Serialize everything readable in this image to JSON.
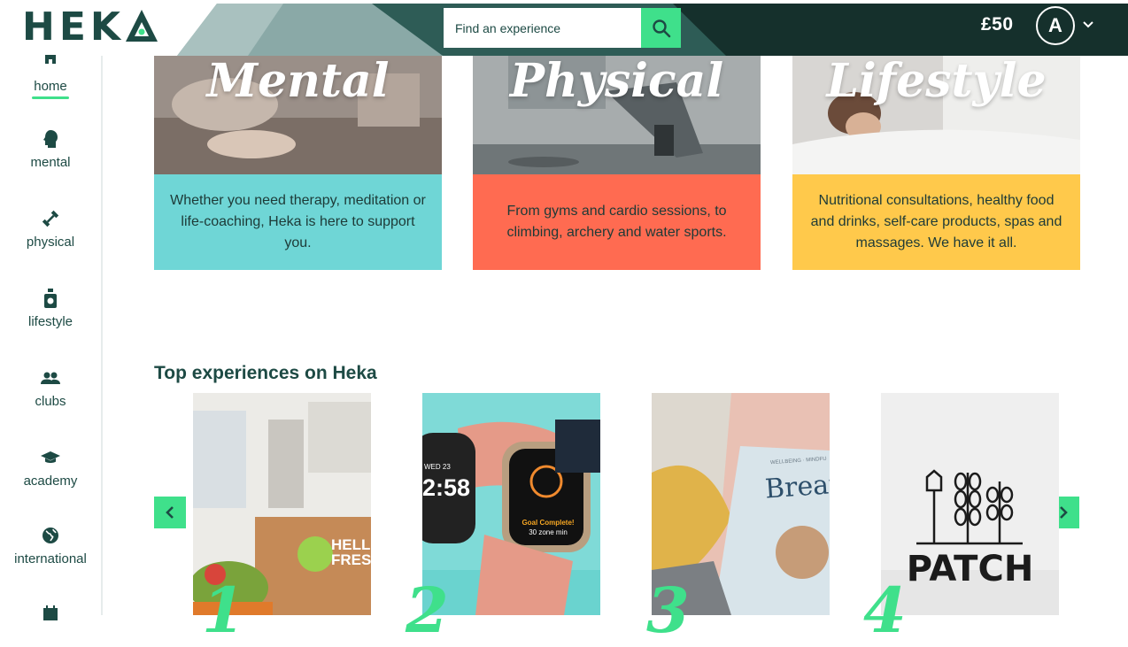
{
  "brand": {
    "logo_text": "HEK"
  },
  "search": {
    "placeholder": "Find an experience"
  },
  "account": {
    "balance": "£50",
    "avatar_initial": "A"
  },
  "sidebar": {
    "items": [
      {
        "label": "home",
        "icon": "home-icon",
        "active": true
      },
      {
        "label": "mental",
        "icon": "head-icon"
      },
      {
        "label": "physical",
        "icon": "dumbbell-icon"
      },
      {
        "label": "lifestyle",
        "icon": "bottle-icon"
      },
      {
        "label": "clubs",
        "icon": "people-icon"
      },
      {
        "label": "academy",
        "icon": "graduation-cap-icon"
      },
      {
        "label": "international",
        "icon": "globe-icon"
      },
      {
        "label": "",
        "icon": "calendar-icon"
      }
    ]
  },
  "categories": [
    {
      "title": "Mental",
      "description": "Whether you need therapy, meditation or life-coaching, Heka is here to support you.",
      "color": "#6fd6d6"
    },
    {
      "title": "Physical",
      "description": "From gyms and cardio sessions, to climbing, archery and water sports.",
      "color": "#ff6b51"
    },
    {
      "title": "Lifestyle",
      "description": "Nutritional consultations, healthy food and drinks, self-care products, spas and massages. We have it all.",
      "color": "#ffc94b"
    }
  ],
  "top_experiences": {
    "title": "Top experiences on Heka",
    "items": [
      {
        "rank": "1",
        "image_text_1": "HELL",
        "image_text_2": "FRES"
      },
      {
        "rank": "2",
        "image_text_1": "WED 23",
        "image_text_2": "2:58",
        "image_text_3": "Goal Complete!",
        "image_text_4": "30 zone min"
      },
      {
        "rank": "3",
        "image_text_1": "WELLBEING · MINDFU",
        "image_text_2": "Breath"
      },
      {
        "rank": "4",
        "image_text_1": "PATCH"
      }
    ]
  },
  "colors": {
    "brand_dark": "#1d4a44",
    "accent": "#3fe08b"
  }
}
